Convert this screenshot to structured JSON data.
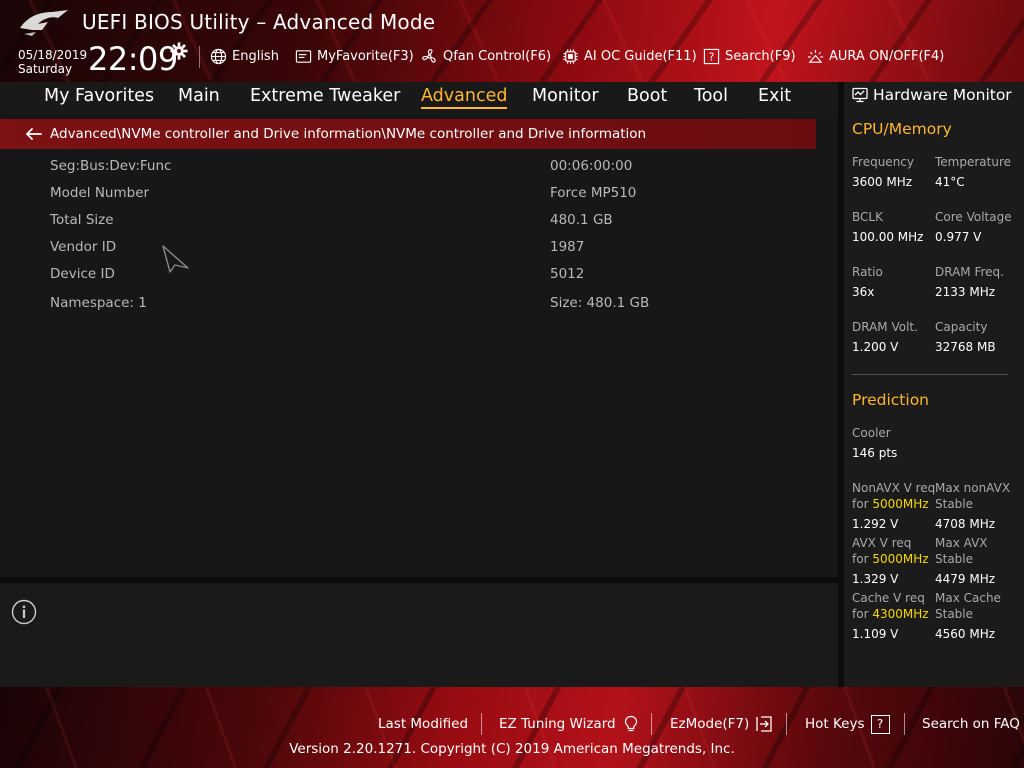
{
  "header": {
    "title": "UEFI BIOS Utility – Advanced Mode",
    "date": "05/18/2019",
    "day": "Saturday",
    "time": "22:09",
    "tools": {
      "language": "English",
      "myfavorite": "MyFavorite(F3)",
      "qfan": "Qfan Control(F6)",
      "aioc": "AI OC Guide(F11)",
      "search": "Search(F9)",
      "aura": "AURA ON/OFF(F4)"
    }
  },
  "tabs": [
    {
      "label": "My Favorites"
    },
    {
      "label": "Main"
    },
    {
      "label": "Extreme Tweaker"
    },
    {
      "label": "Advanced"
    },
    {
      "label": "Monitor"
    },
    {
      "label": "Boot"
    },
    {
      "label": "Tool"
    },
    {
      "label": "Exit"
    }
  ],
  "breadcrumb": "Advanced\\NVMe controller and Drive information\\NVMe controller and Drive information",
  "rows": [
    {
      "label": "Seg:Bus:Dev:Func",
      "value": "00:06:00:00"
    },
    {
      "label": "Model Number",
      "value": "Force MP510"
    },
    {
      "label": "Total Size",
      "value": "480.1 GB"
    },
    {
      "label": "Vendor ID",
      "value": "1987"
    },
    {
      "label": "Device ID",
      "value": "5012"
    },
    {
      "label": "Namespace: 1",
      "value": "Size: 480.1 GB"
    }
  ],
  "monitor": {
    "title": "Hardware Monitor",
    "cpu_section": "CPU/Memory",
    "cpu": {
      "frequency_label": "Frequency",
      "frequency": "3600 MHz",
      "temperature_label": "Temperature",
      "temperature": "41°C",
      "bclk_label": "BCLK",
      "bclk": "100.00 MHz",
      "core_voltage_label": "Core Voltage",
      "core_voltage": "0.977 V",
      "ratio_label": "Ratio",
      "ratio": "36x",
      "dram_freq_label": "DRAM Freq.",
      "dram_freq": "2133 MHz",
      "dram_volt_label": "DRAM Volt.",
      "dram_volt": "1.200 V",
      "capacity_label": "Capacity",
      "capacity": "32768 MB"
    },
    "prediction_section": "Prediction",
    "prediction": {
      "cooler_label": "Cooler",
      "cooler": "146 pts",
      "nonavx_req_l1": "NonAVX V req",
      "for_word": "for ",
      "nonavx_freq": "5000MHz",
      "nonavx_req": "1.292 V",
      "max_nonavx_l1": "Max nonAVX",
      "stable_word": "Stable",
      "max_nonavx": "4708 MHz",
      "avx_req_l1": "AVX V req",
      "avx_freq": "5000MHz",
      "avx_req": "1.329 V",
      "max_avx_l1": "Max AVX",
      "max_avx": "4479 MHz",
      "cache_req_l1": "Cache V req",
      "cache_freq": "4300MHz",
      "cache_req": "1.109 V",
      "max_cache_l1": "Max Cache",
      "max_cache": "4560 MHz"
    }
  },
  "footer": {
    "last_modified": "Last Modified",
    "ez_tuning": "EZ Tuning Wizard",
    "ezmode": "EzMode(F7)",
    "hot_keys": "Hot Keys",
    "hot_keys_glyph": "?",
    "search_faq": "Search on FAQ",
    "copyright": "Version 2.20.1271. Copyright (C) 2019 American Megatrends, Inc."
  },
  "colors": {
    "accent": "#ffb52e",
    "highlight": "#f5d800",
    "breadcrumb_bg": "#7d1113",
    "brand_red": "#c0141b"
  },
  "icons": [
    "rog-logo",
    "gear-icon",
    "globe-icon",
    "favorite-icon",
    "fan-icon",
    "chip-icon",
    "search-icon",
    "aura-icon",
    "back-arrow-icon",
    "monitor-icon",
    "info-icon",
    "lightbulb-icon",
    "exit-arrow-icon"
  ]
}
